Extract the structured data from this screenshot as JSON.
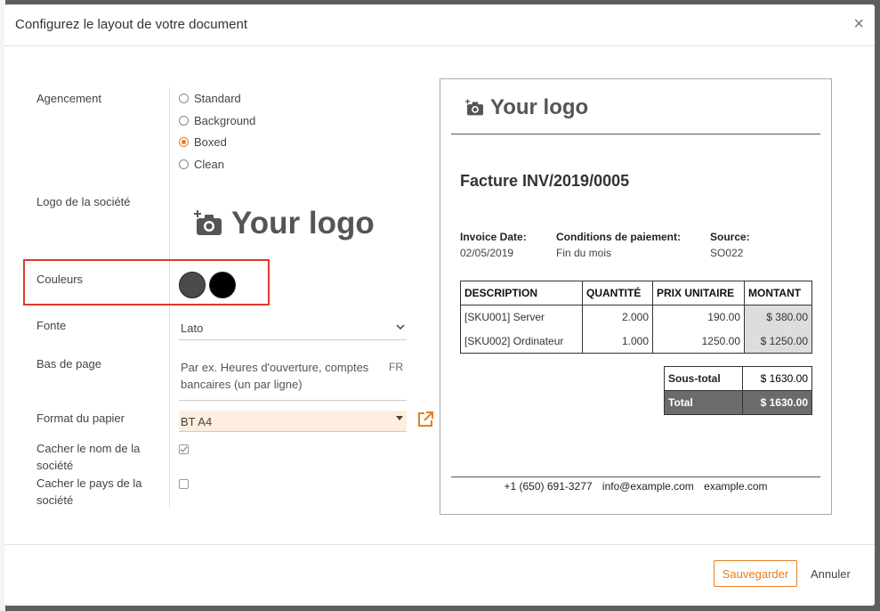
{
  "dialog": {
    "title": "Configurez le layout de votre document",
    "close_glyph": "×"
  },
  "form": {
    "layout_label": "Agencement",
    "layout_options": [
      {
        "label": "Standard",
        "checked": false
      },
      {
        "label": "Background",
        "checked": false
      },
      {
        "label": "Boxed",
        "checked": true
      },
      {
        "label": "Clean",
        "checked": false
      }
    ],
    "logo_label": "Logo de la société",
    "logo_text": "Your logo",
    "colors_label": "Couleurs",
    "colors": [
      "#4a4a4a",
      "#000000"
    ],
    "font_label": "Fonte",
    "font_value": "Lato",
    "footer_label": "Bas de page",
    "footer_placeholder": "Par ex. Heures d'ouverture, comptes bancaires (un par ligne)",
    "footer_lang": "FR",
    "paper_label": "Format du papier",
    "paper_value": "BT A4",
    "hide_name_label": "Cacher le nom de la société",
    "hide_name_checked": true,
    "hide_country_label": "Cacher le pays de la société",
    "hide_country_checked": false
  },
  "preview": {
    "logo_text": "Your logo",
    "title": "Facture INV/2019/0005",
    "info": [
      {
        "label": "Invoice Date:",
        "value": "02/05/2019"
      },
      {
        "label": "Conditions de paiement:",
        "value": "Fin du mois"
      },
      {
        "label": "Source:",
        "value": "SO022"
      }
    ],
    "columns": [
      "DESCRIPTION",
      "QUANTITÉ",
      "PRIX UNITAIRE",
      "MONTANT"
    ],
    "rows": [
      {
        "description": "[SKU001] Server",
        "qty": "2.000",
        "price": "190.00",
        "amount": "$ 380.00"
      },
      {
        "description": "[SKU002] Ordinateur",
        "qty": "1.000",
        "price": "1250.00",
        "amount": "$ 1250.00"
      }
    ],
    "subtotal_label": "Sous-total",
    "subtotal_value": "$ 1630.00",
    "total_label": "Total",
    "total_value": "$ 1630.00",
    "footer_phone": "+1 (650) 691-3277",
    "footer_email": "info@example.com",
    "footer_web": "example.com"
  },
  "buttons": {
    "save": "Sauvegarder",
    "cancel": "Annuler"
  },
  "accent_color": "#e67e22",
  "highlight_color": "#e0392b"
}
